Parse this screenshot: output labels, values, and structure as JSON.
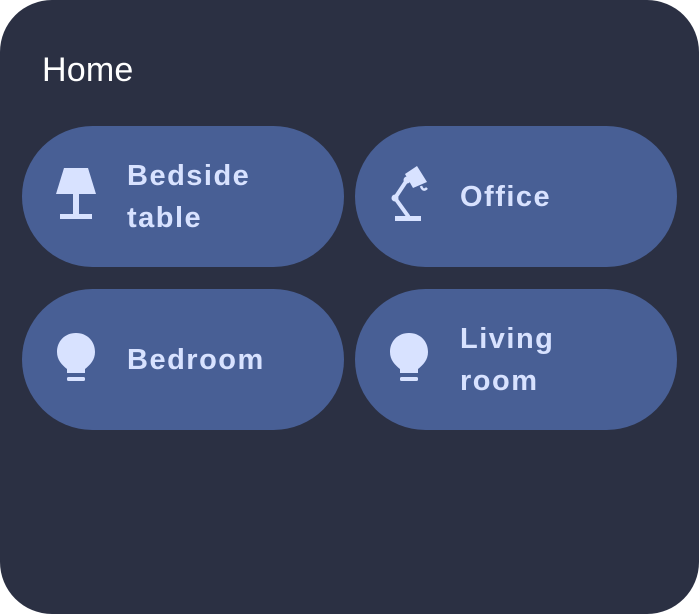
{
  "widget": {
    "title": "Home",
    "tiles": [
      {
        "label": "Bedside\ntable",
        "icon": "table-lamp-icon"
      },
      {
        "label": "Office",
        "icon": "desk-lamp-icon"
      },
      {
        "label": "Bedroom",
        "icon": "light-bulb-icon"
      },
      {
        "label": "Living\nroom",
        "icon": "light-bulb-icon"
      }
    ]
  },
  "colors": {
    "background": "#2b3043",
    "tile": "#485f95",
    "tile_text": "#d8e2ff",
    "title_text": "#ffffff"
  }
}
